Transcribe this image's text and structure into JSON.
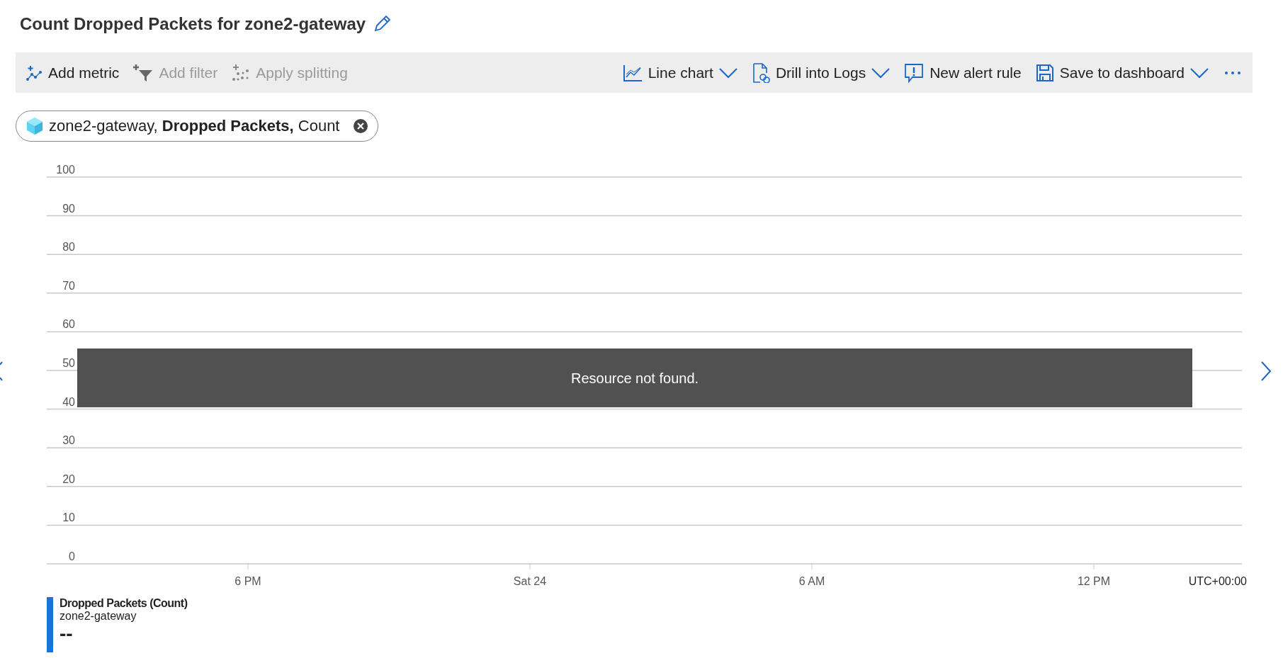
{
  "title": "Count Dropped Packets for zone2-gateway",
  "toolbar": {
    "left": [
      {
        "label": "Add metric",
        "disabled": false
      },
      {
        "label": "Add filter",
        "disabled": true
      },
      {
        "label": "Apply splitting",
        "disabled": true
      }
    ],
    "right": [
      {
        "label": "Line chart",
        "dropdown": true
      },
      {
        "label": "Drill into Logs",
        "dropdown": true
      },
      {
        "label": "New alert rule",
        "dropdown": false
      },
      {
        "label": "Save to dashboard",
        "dropdown": true
      }
    ]
  },
  "metric_pill": {
    "resource": "zone2-gateway,",
    "metric": "Dropped Packets,",
    "aggregation": "Count"
  },
  "chart": {
    "message": "Resource not found.",
    "timezone": "UTC+00:00",
    "chart_data": {
      "type": "line",
      "categories": [
        "6 PM",
        "Sat 24",
        "6 AM",
        "12 PM"
      ],
      "ylim": [
        0,
        100
      ],
      "grid": true,
      "yticks": [
        0,
        10,
        20,
        30,
        40,
        50,
        60,
        70,
        80,
        90,
        100
      ],
      "series": [
        {
          "name": "Dropped Packets (Count)",
          "color": "#1b74d3",
          "values": [
            null,
            null,
            null,
            null
          ]
        }
      ]
    },
    "legend": [
      {
        "subtitle": "zone2-gateway",
        "value": "--"
      }
    ]
  }
}
